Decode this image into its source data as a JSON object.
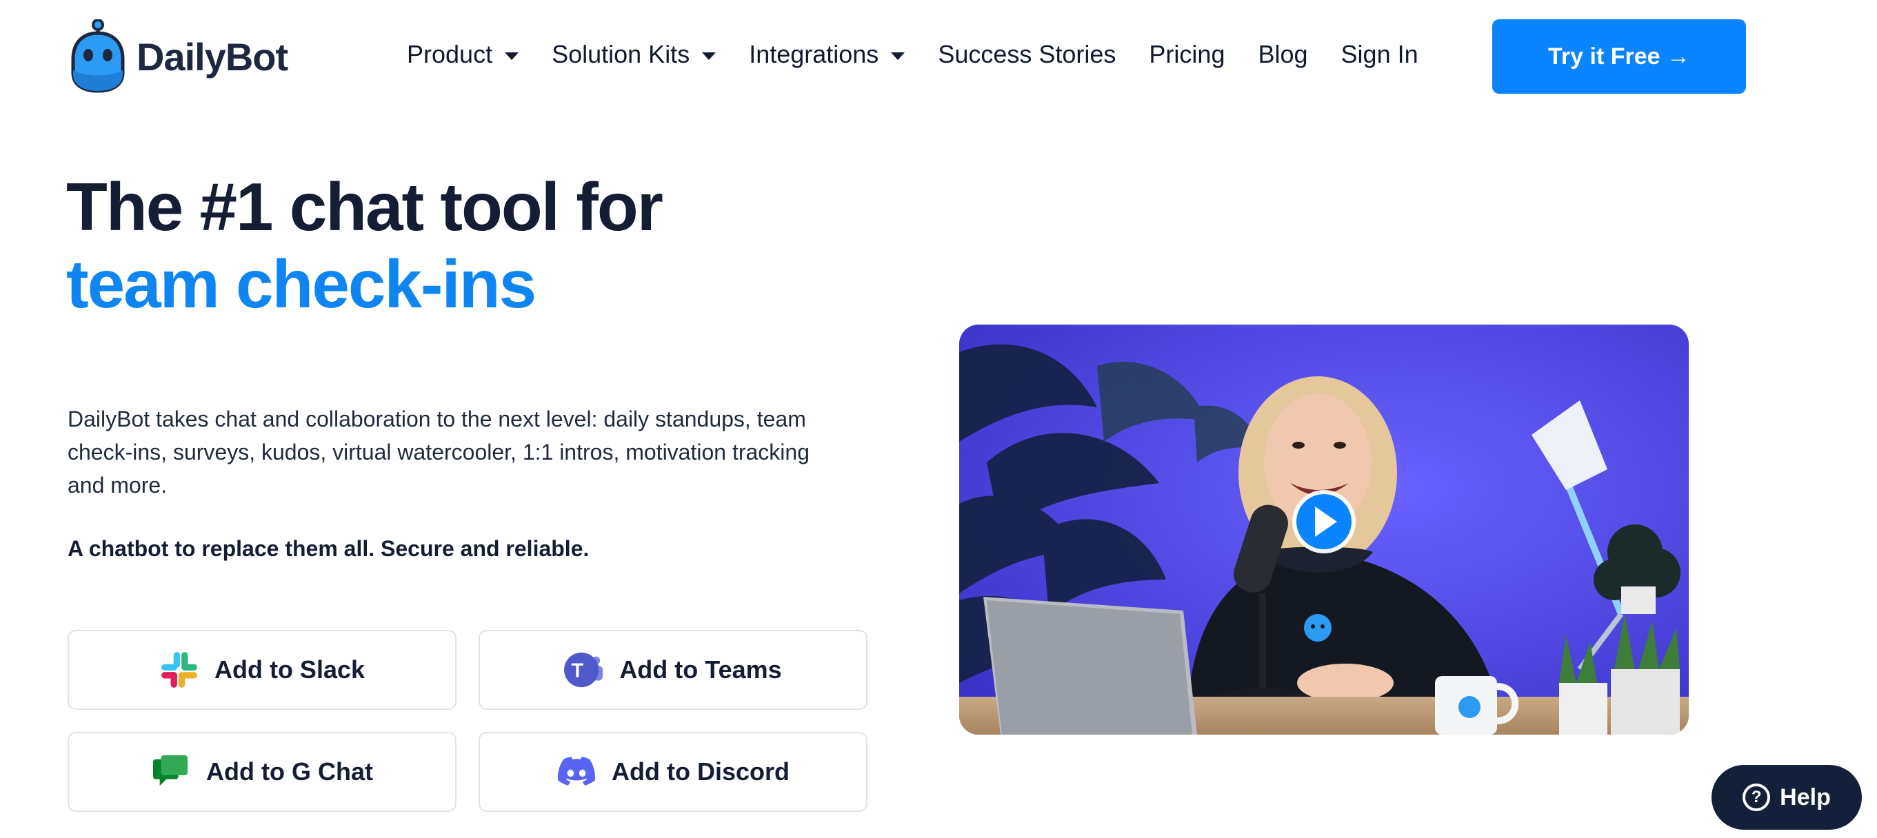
{
  "header": {
    "logo_text": "DailyBot",
    "nav": [
      {
        "label": "Product",
        "dropdown": true
      },
      {
        "label": "Solution Kits",
        "dropdown": true
      },
      {
        "label": "Integrations",
        "dropdown": true
      },
      {
        "label": "Success Stories",
        "dropdown": false
      },
      {
        "label": "Pricing",
        "dropdown": false
      },
      {
        "label": "Blog",
        "dropdown": false
      },
      {
        "label": "Sign In",
        "dropdown": false
      }
    ],
    "cta_label": "Try it Free →"
  },
  "hero": {
    "headline_line1": "The #1 chat tool for",
    "headline_line2": "team check-ins",
    "description": "DailyBot takes chat and collaboration to the next level: daily standups, team check-ins, surveys, kudos, virtual watercooler, 1:1 intros, motivation tracking and more.",
    "tagline": "A chatbot to replace them all. Secure and reliable.",
    "buttons": {
      "slack": "Add to Slack",
      "teams": "Add to Teams",
      "gchat": "Add to G Chat",
      "discord": "Add to Discord"
    }
  },
  "help_label": "Help",
  "colors": {
    "brand_blue": "#0a84ff",
    "headline_accent": "#0f85f2",
    "dark_navy": "#141d33",
    "help_bg": "#14203a",
    "video_bg": "#5148e6"
  },
  "icons": [
    "dailybot-logo-icon",
    "caret-down-icon",
    "slack-icon",
    "teams-icon",
    "google-chat-icon",
    "discord-icon",
    "play-icon",
    "question-icon"
  ]
}
